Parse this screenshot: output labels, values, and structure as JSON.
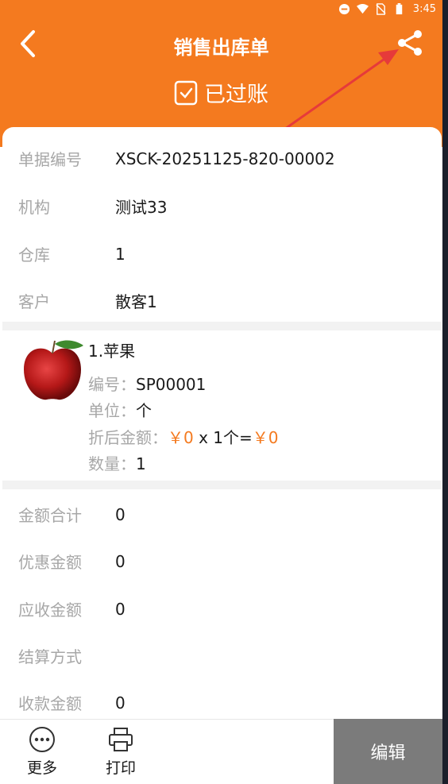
{
  "status": {
    "time": "3:45"
  },
  "header": {
    "title": "销售出库单",
    "posted_label": "已过账"
  },
  "colors": {
    "accent": "#f47a1f",
    "label": "#a7a7a7",
    "edit_bg": "#7b7b7b"
  },
  "icons": [
    "back-arrow-icon",
    "share-icon",
    "checkbox-icon",
    "more-icon",
    "printer-icon",
    "apple-image"
  ],
  "info": [
    {
      "label": "单据编号",
      "value": "XSCK-20251125-820-00002"
    },
    {
      "label": "机构",
      "value": "测试33"
    },
    {
      "label": "仓库",
      "value": "1"
    },
    {
      "label": "客户",
      "value": "散客1"
    }
  ],
  "item": {
    "name": "1.苹果",
    "code_label": "编号：",
    "code": "SP00001",
    "unit_label": "单位：",
    "unit": "个",
    "price_label": "折后金额：",
    "price": "￥0",
    "multiply": "x 1个=",
    "total": "￥0",
    "qty_label": "数量：",
    "qty": "1"
  },
  "summary": [
    {
      "label": "金额合计",
      "value": "0"
    },
    {
      "label": "优惠金额",
      "value": "0"
    },
    {
      "label": "应收金额",
      "value": "0"
    },
    {
      "label": "结算方式",
      "value": ""
    },
    {
      "label": "收款金额",
      "value": "0"
    }
  ],
  "bottom": {
    "more_label": "更多",
    "print_label": "打印",
    "edit_label": "编辑"
  }
}
